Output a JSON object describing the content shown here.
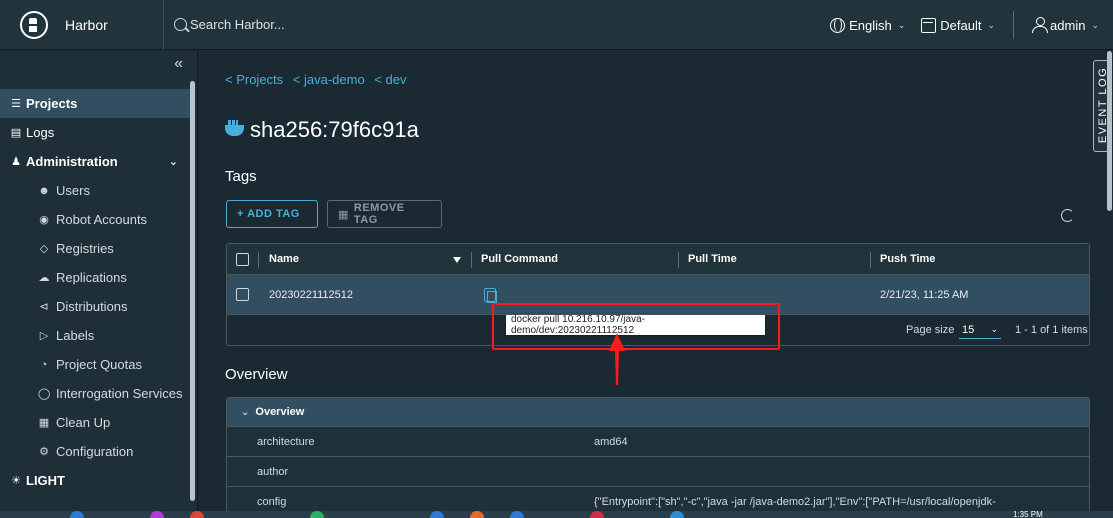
{
  "header": {
    "brand": "Harbor",
    "search_placeholder": "Search Harbor...",
    "language": "English",
    "theme_default": "Default",
    "user": "admin"
  },
  "sidebar": {
    "collapse_icon": "double-chevron-left-icon",
    "items": [
      {
        "label": "Projects",
        "icon": "projects-icon"
      },
      {
        "label": "Logs",
        "icon": "logs-icon"
      },
      {
        "label": "Administration",
        "icon": "administration-icon"
      },
      {
        "label": "Users",
        "icon": "users-icon"
      },
      {
        "label": "Robot Accounts",
        "icon": "robot-icon"
      },
      {
        "label": "Registries",
        "icon": "registries-icon"
      },
      {
        "label": "Replications",
        "icon": "replications-icon"
      },
      {
        "label": "Distributions",
        "icon": "distributions-icon"
      },
      {
        "label": "Labels",
        "icon": "labels-icon"
      },
      {
        "label": "Project Quotas",
        "icon": "quotas-icon"
      },
      {
        "label": "Interrogation Services",
        "icon": "shield-icon"
      },
      {
        "label": "Clean Up",
        "icon": "trash-icon"
      },
      {
        "label": "Configuration",
        "icon": "gear-icon"
      },
      {
        "label": "LIGHT",
        "icon": "sun-icon"
      }
    ]
  },
  "breadcrumb": [
    "< Projects",
    "< java-demo",
    "< dev"
  ],
  "artifact_title": "sha256:79f6c91a",
  "tags": {
    "heading": "Tags",
    "add_tag": "+ ADD TAG",
    "remove_tag": "REMOVE TAG",
    "columns": [
      "Name",
      "Pull Command",
      "Pull Time",
      "Push Time"
    ],
    "rows": [
      {
        "name": "20230221112512",
        "pull_time": "",
        "push_time": "2/21/23, 11:25 AM"
      }
    ],
    "page_size_label": "Page size",
    "page_size": "15",
    "range": "1 - 1 of 1 items"
  },
  "tooltip": "docker pull 10.216.10.97/java-demo/dev:20230221112512",
  "overview": {
    "heading": "Overview",
    "panel_title": "Overview",
    "rows": [
      {
        "key": "architecture",
        "value": "amd64"
      },
      {
        "key": "author",
        "value": ""
      },
      {
        "key": "config",
        "value": "{\"Entrypoint\":[\"sh\",\"-c\",\"java -jar /java-demo2.jar\"],\"Env\":[\"PATH=/usr/local/openjdk-"
      }
    ]
  },
  "event_log": "EVENT LOG",
  "clock": "1:35 PM",
  "colors": {
    "accent": "#4aaed9",
    "highlight": "#ff1a1a"
  }
}
